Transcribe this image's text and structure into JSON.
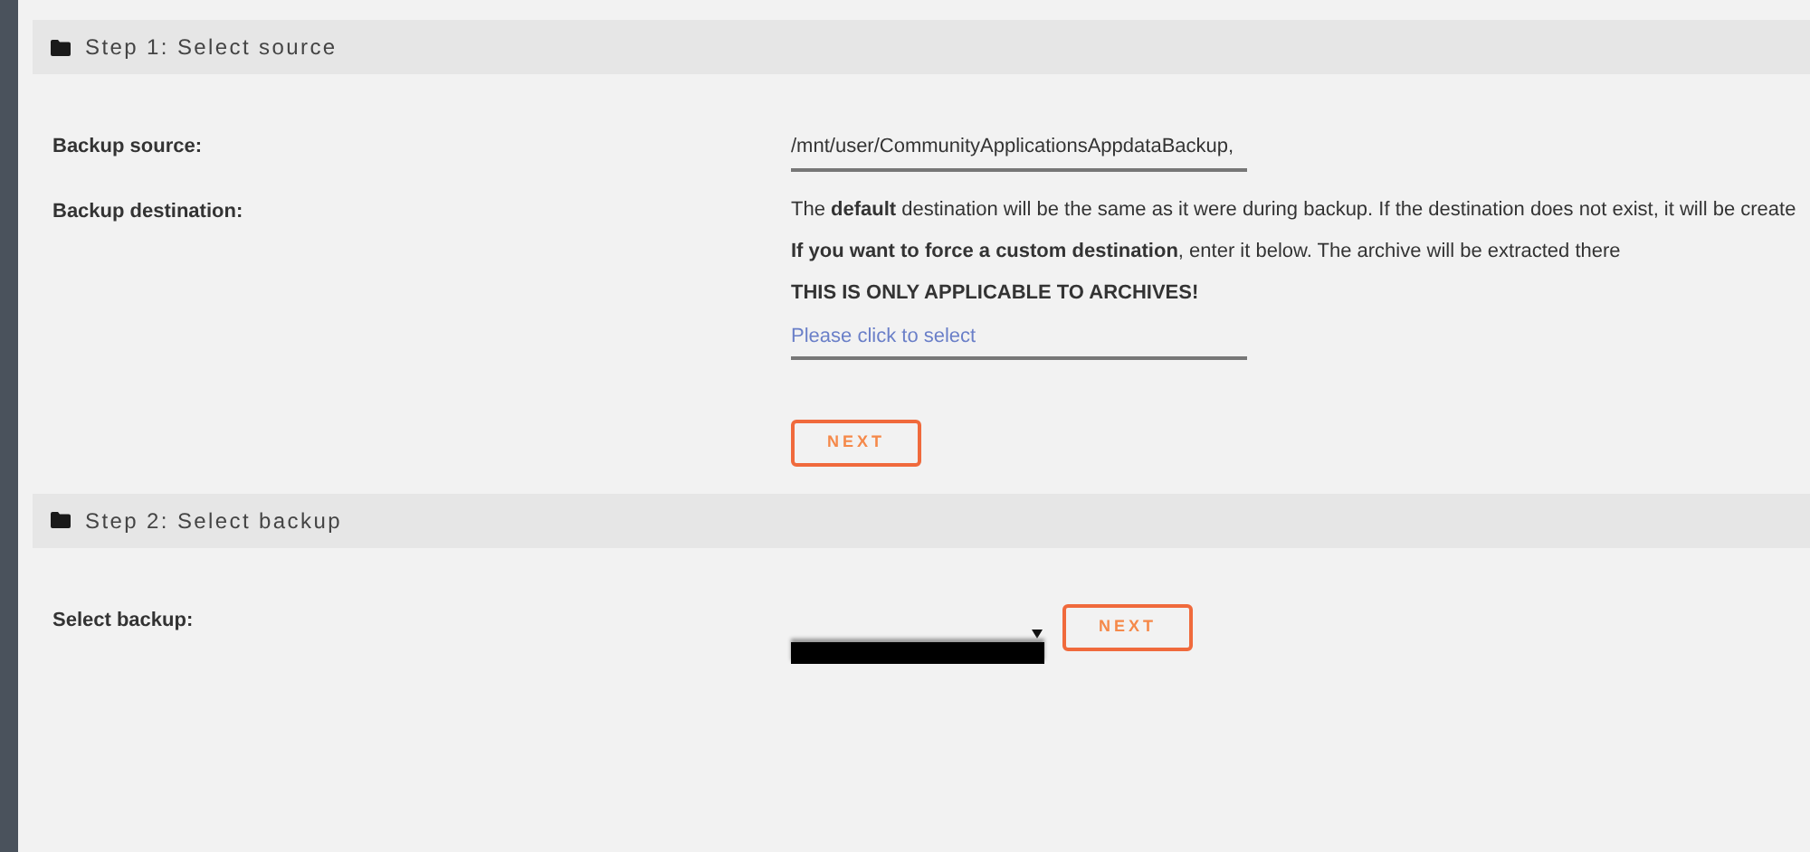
{
  "sections": [
    {
      "title": "Step 1: Select source",
      "rows": [
        {
          "kind": "field",
          "label": "Backup source:",
          "value": "/mnt/user/CommunityApplicationsAppdataBackup,"
        },
        {
          "kind": "destination",
          "label": "Backup destination:",
          "lines": [
            "The **default** destination will be the same as it were during backup. If the destination does not exist, it will be create",
            "**If you want to force a custom destination**, enter it below. The archive will be extracted there",
            "**THIS IS ONLY APPLICABLE TO ARCHIVES!**"
          ],
          "placeholder": "Please click to select"
        }
      ],
      "button": "NEXT"
    },
    {
      "title": "Step 2: Select backup",
      "rows": [
        {
          "kind": "select",
          "label": "Select backup:",
          "button": "NEXT"
        }
      ]
    }
  ]
}
